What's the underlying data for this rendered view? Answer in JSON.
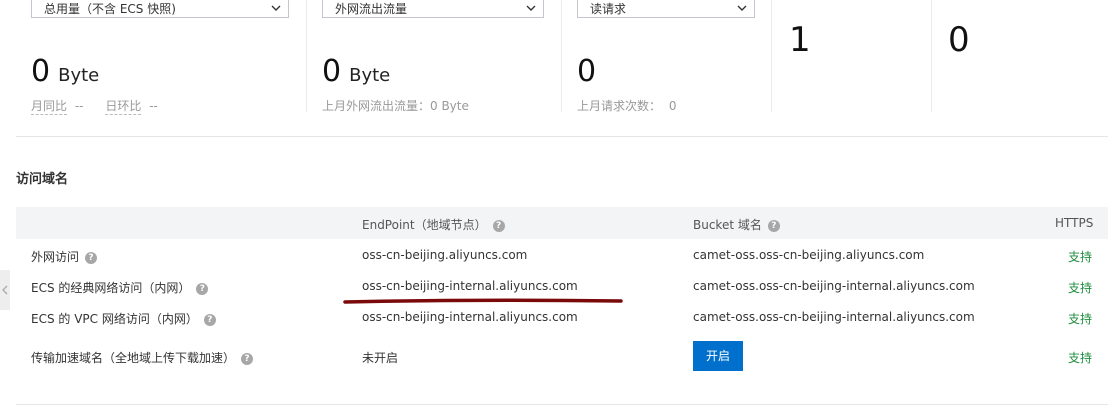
{
  "stats": {
    "usage": {
      "dropdown": "总用量（不含 ECS 快照)",
      "value": "0",
      "unit": "Byte",
      "yoy_label": "月同比",
      "yoy_value": "--",
      "mom_label": "日环比",
      "mom_value": "--"
    },
    "outbound": {
      "dropdown": "外网流出流量",
      "value": "0",
      "unit": "Byte",
      "note": "上月外网流出流量：0 Byte"
    },
    "requests": {
      "dropdown": "读请求",
      "value": "0",
      "note_label": "上月请求次数：",
      "note_value": "0"
    },
    "col4": {
      "value": "1"
    },
    "col5": {
      "value": "0"
    }
  },
  "domains": {
    "title": "访问域名",
    "headers": {
      "endpoint": "EndPoint（地域节点）",
      "bucket": "Bucket 域名",
      "https": "HTTPS"
    },
    "rows": [
      {
        "name": "外网访问",
        "endpoint": "oss-cn-beijing.aliyuncs.com",
        "bucket": "camet-oss.oss-cn-beijing.aliyuncs.com",
        "https": "支持"
      },
      {
        "name": "ECS 的经典网络访问（内网）",
        "endpoint": "oss-cn-beijing-internal.aliyuncs.com",
        "bucket": "camet-oss.oss-cn-beijing-internal.aliyuncs.com",
        "https": "支持"
      },
      {
        "name": "ECS 的 VPC 网络访问（内网）",
        "endpoint": "oss-cn-beijing-internal.aliyuncs.com",
        "bucket": "camet-oss.oss-cn-beijing-internal.aliyuncs.com",
        "https": "支持"
      },
      {
        "name": "传输加速域名（全地域上传下载加速）",
        "endpoint": "未开启",
        "button": "开启",
        "https": "支持"
      }
    ]
  },
  "colors": {
    "support": "#1e8e3e",
    "button": "#0070cc",
    "annotation": "#7a0a0a"
  },
  "icons": {
    "help": "question-circle-icon",
    "dropdown": "chevron-down-icon"
  }
}
